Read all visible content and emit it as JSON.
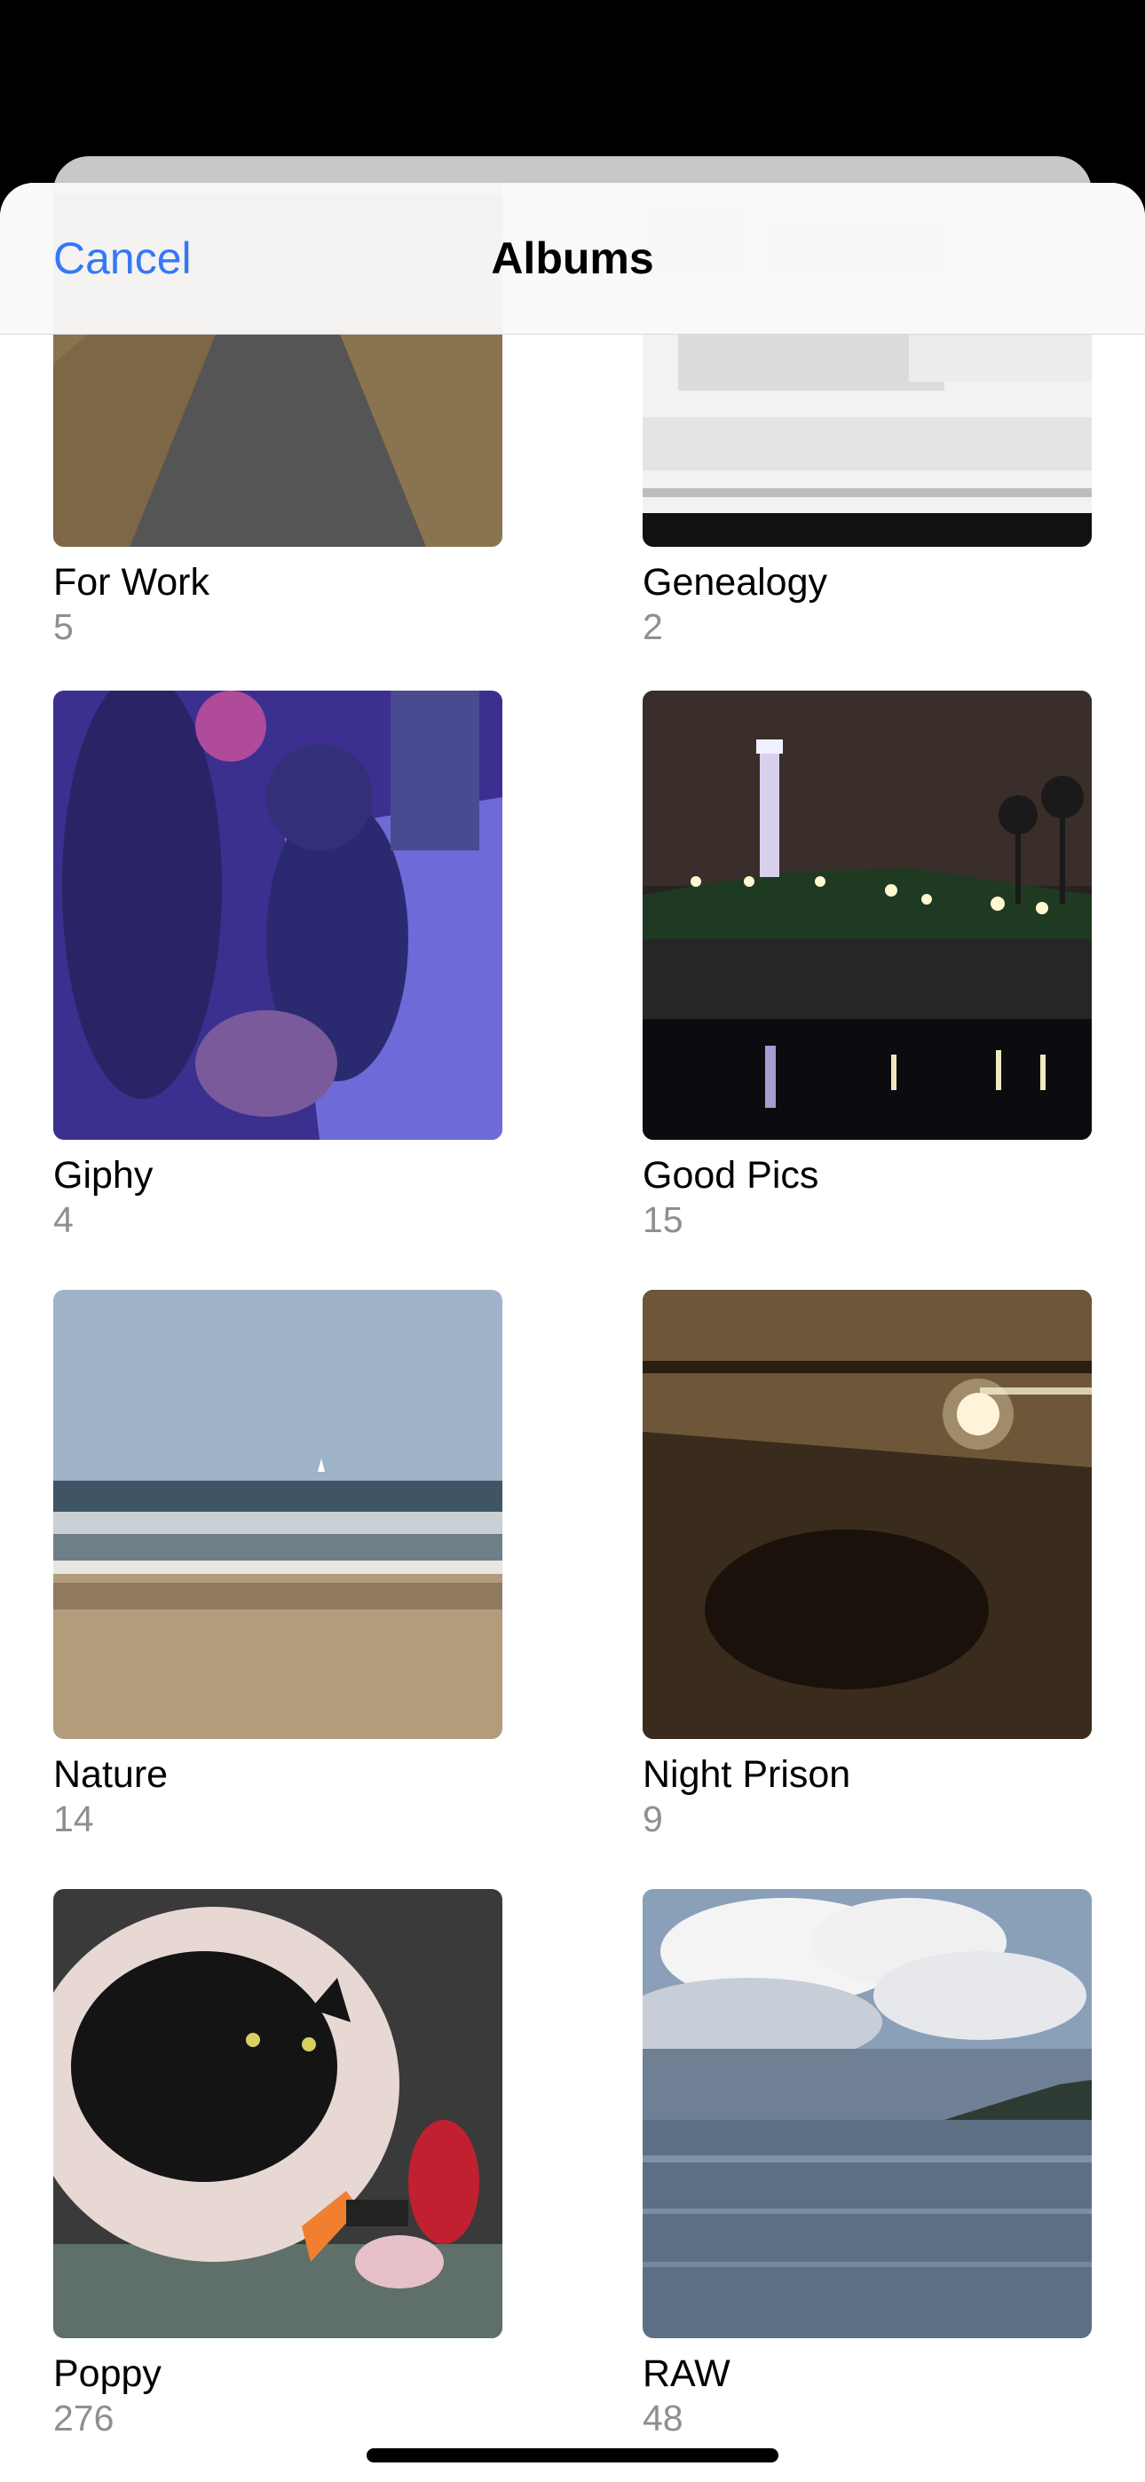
{
  "nav": {
    "cancel_label": "Cancel",
    "title": "Albums"
  },
  "albums": [
    {
      "name": "For Work",
      "count": "5"
    },
    {
      "name": "Genealogy",
      "count": "2"
    },
    {
      "name": "Giphy",
      "count": "4"
    },
    {
      "name": "Good Pics",
      "count": "15"
    },
    {
      "name": "Nature",
      "count": "14"
    },
    {
      "name": "Night Prison",
      "count": "9"
    },
    {
      "name": "Poppy",
      "count": "276"
    },
    {
      "name": "RAW",
      "count": "48"
    }
  ],
  "colors": {
    "accent": "#3478f6",
    "secondary_text": "#8e8e93"
  }
}
